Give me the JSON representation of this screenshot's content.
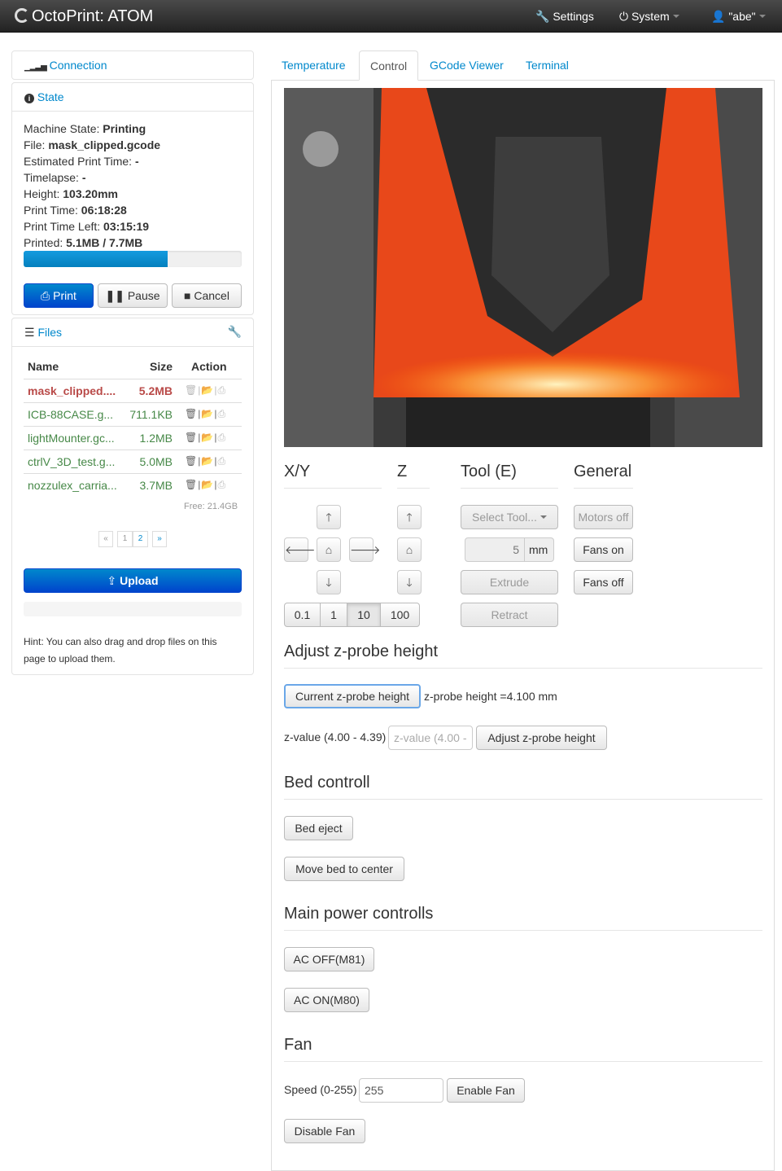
{
  "navbar": {
    "brand": "OctoPrint: ATOM",
    "settings": "Settings",
    "system": "System",
    "user": "\"abe\""
  },
  "sidebar": {
    "connection": "Connection",
    "state": {
      "title": "State",
      "machine_state_label": "Machine State:",
      "machine_state": "Printing",
      "file_label": "File:",
      "file": "mask_clipped.gcode",
      "est_label": "Estimated Print Time:",
      "est": "-",
      "timelapse_label": "Timelapse:",
      "timelapse": "-",
      "height_label": "Height:",
      "height": "103.20mm",
      "print_time_label": "Print Time:",
      "print_time": "06:18:28",
      "time_left_label": "Print Time Left:",
      "time_left": "03:15:19",
      "printed_label": "Printed:",
      "printed": "5.1MB / 7.7MB",
      "progress": 0.66,
      "print": "Print",
      "pause": "Pause",
      "cancel": "Cancel"
    },
    "files": {
      "title": "Files",
      "headers": {
        "name": "Name",
        "size": "Size",
        "action": "Action"
      },
      "rows": [
        {
          "name": "mask_clipped....",
          "size": "5.2MB"
        },
        {
          "name": "ICB-88CASE.g...",
          "size": "711.1KB"
        },
        {
          "name": "lightMounter.gc...",
          "size": "1.2MB"
        },
        {
          "name": "ctrlV_3D_test.g...",
          "size": "5.0MB"
        },
        {
          "name": "nozzulex_carria...",
          "size": "3.7MB"
        }
      ],
      "free": "Free: 21.4GB",
      "pages": {
        "prev": "«",
        "p1": "1",
        "p2": "2",
        "next": "»"
      },
      "upload": "Upload",
      "hint": "Hint: You can also drag and drop files on this page to upload them."
    }
  },
  "tabs": {
    "temperature": "Temperature",
    "control": "Control",
    "gcode": "GCode Viewer",
    "terminal": "Terminal"
  },
  "control": {
    "xy": "X/Y",
    "z": "Z",
    "tool": "Tool (E)",
    "general": "General",
    "steps": [
      "0.1",
      "1",
      "10",
      "100"
    ],
    "select_tool": "Select Tool...",
    "extrude_amount": "5",
    "mm": "mm",
    "extrude": "Extrude",
    "retract": "Retract",
    "motors_off": "Motors off",
    "fans_on": "Fans on",
    "fans_off": "Fans off"
  },
  "zprobe": {
    "title": "Adjust z-probe height",
    "current_btn": "Current z-probe height",
    "current_text": "z-probe height =4.100 mm",
    "zvalue_label": "z-value (4.00 - 4.39)",
    "zvalue_placeholder": "z-value (4.00 -",
    "adjust_btn": "Adjust z-probe height"
  },
  "bed": {
    "title": "Bed controll",
    "eject": "Bed eject",
    "center": "Move bed to center"
  },
  "power": {
    "title": "Main power controlls",
    "off": "AC OFF(M81)",
    "on": "AC ON(M80)"
  },
  "fan": {
    "title": "Fan",
    "speed_label": "Speed (0-255)",
    "speed": "255",
    "enable": "Enable Fan",
    "disable": "Disable Fan"
  }
}
